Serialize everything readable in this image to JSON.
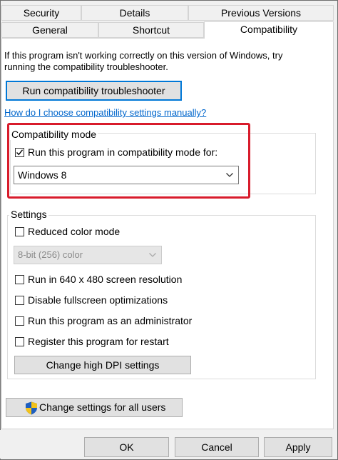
{
  "tabs": {
    "row1": [
      "Security",
      "Details",
      "Previous Versions"
    ],
    "row2": [
      "General",
      "Shortcut",
      "Compatibility"
    ]
  },
  "intro_text_line1": "If this program isn't working correctly on this version of Windows, try",
  "intro_text_line2": "running the compatibility troubleshooter.",
  "troubleshooter_button": "Run compatibility troubleshooter",
  "help_link": "How do I choose compatibility settings manually?",
  "compatibility_mode": {
    "group_label": "Compatibility mode",
    "checkbox_label": "Run this program in compatibility mode for:",
    "checked": true,
    "selected_os": "Windows 8"
  },
  "settings": {
    "group_label": "Settings",
    "reduced_color_label": "Reduced color mode",
    "color_depth_value": "8-bit (256) color",
    "res_640_label": "Run in 640 x 480 screen resolution",
    "fullscreen_opt_label": "Disable fullscreen optimizations",
    "admin_label": "Run this program as an administrator",
    "restart_label": "Register this program for restart",
    "dpi_button": "Change high DPI settings"
  },
  "all_users_button": "Change settings for all users",
  "footer": {
    "ok": "OK",
    "cancel": "Cancel",
    "apply": "Apply"
  },
  "colors": {
    "highlight": "#d81b2b",
    "link": "#0066cc",
    "focus": "#0078d7"
  }
}
